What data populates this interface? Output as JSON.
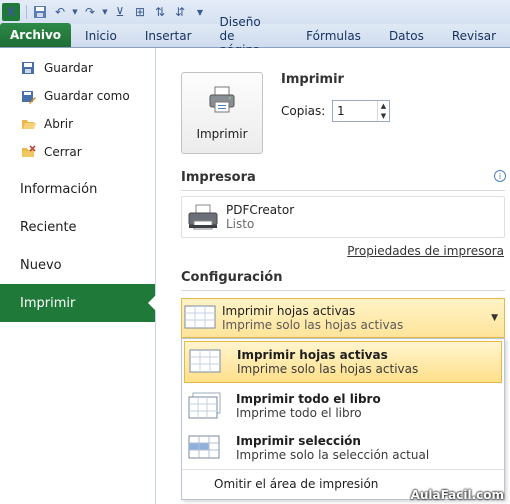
{
  "tabs": [
    "Archivo",
    "Inicio",
    "Insertar",
    "Diseño de página",
    "Fórmulas",
    "Datos",
    "Revisar"
  ],
  "nav": {
    "commands": [
      {
        "label": "Guardar",
        "icon": "save-icon"
      },
      {
        "label": "Guardar como",
        "icon": "save-as-icon"
      },
      {
        "label": "Abrir",
        "icon": "open-folder-icon"
      },
      {
        "label": "Cerrar",
        "icon": "close-folder-icon"
      }
    ],
    "sections": [
      "Información",
      "Reciente",
      "Nuevo",
      "Imprimir"
    ],
    "active": "Imprimir"
  },
  "print": {
    "button_label": "Imprimir",
    "title": "Imprimir",
    "copies_label": "Copias:",
    "copies_value": "1"
  },
  "printer": {
    "section_title": "Impresora",
    "name": "PDFCreator",
    "status": "Listo",
    "properties_link": "Propiedades de impresora"
  },
  "config": {
    "section_title": "Configuración",
    "selected_title": "Imprimir hojas activas",
    "selected_desc": "Imprime solo las hojas activas",
    "options": [
      {
        "title": "Imprimir hojas activas",
        "desc": "Imprime solo las hojas activas"
      },
      {
        "title": "Imprimir todo el libro",
        "desc": "Imprime todo el libro"
      },
      {
        "title": "Imprimir selección",
        "desc": "Imprime solo la selección actual"
      }
    ],
    "omit_label": "Omitir el área de impresión"
  },
  "watermark": "AulaFacil.com",
  "colors": {
    "file_tab": "#1f7a3a",
    "active_nav": "#1f7a3a",
    "highlight": "#ffe49a"
  }
}
